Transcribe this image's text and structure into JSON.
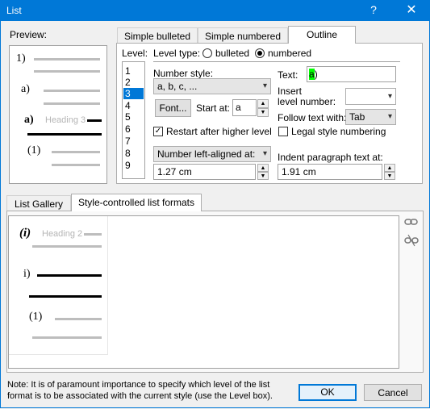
{
  "window": {
    "title": "List",
    "help": "?",
    "close": "✕"
  },
  "preview": {
    "label": "Preview:",
    "rows": [
      "1)",
      "a)",
      "a)",
      "Heading 3",
      "(1)"
    ]
  },
  "tabs": [
    "Simple bulleted",
    "Simple numbered",
    "Outline"
  ],
  "outline": {
    "level_label": "Level:",
    "levels": [
      "1",
      "2",
      "3",
      "4",
      "5",
      "6",
      "7",
      "8",
      "9"
    ],
    "level_selected": "3",
    "level_type_label": "Level type:",
    "bulleted": "bulleted",
    "numbered": "numbered",
    "number_style_label": "Number style:",
    "number_style": "a, b, c, ...",
    "font_button": "Font...",
    "start_at_label": "Start at:",
    "start_at": "a",
    "restart_label": "Restart after higher level",
    "number_align": "Number left-aligned at:",
    "number_align_value": "1.27 cm",
    "text_label": "Text:",
    "text_value_code": "a",
    "text_value_suffix": ")",
    "insert_level_label_1": "Insert",
    "insert_level_label_2": "level number:",
    "follow_text_label": "Follow text with:",
    "follow_text_value": "Tab",
    "legal_label": "Legal style numbering",
    "indent_label": "Indent paragraph text at:",
    "indent_value": "1.91 cm"
  },
  "lower_tabs": [
    "List Gallery",
    "Style-controlled list formats"
  ],
  "gallery": {
    "rows": [
      "(i)",
      "Heading 2",
      "i)",
      "(1)"
    ]
  },
  "note": {
    "line1": "Note: It is of paramount importance to specify which level of the list",
    "line2": "format is to be associated with the current style (use the Level box)."
  },
  "buttons": {
    "ok": "OK",
    "cancel": "Cancel"
  },
  "colors": {
    "titlebar": "#0078d7",
    "selection": "#0078d7",
    "highlight_code": "#00ff00"
  }
}
